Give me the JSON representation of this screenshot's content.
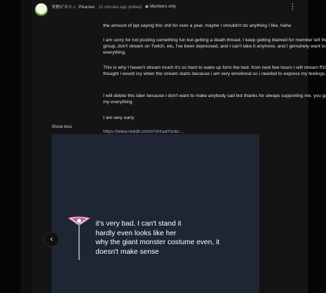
{
  "author": {
    "username": "天野ピカミィ. Pikamee",
    "timestamp": "22 minutes ago (edited)",
    "badge": "Members only"
  },
  "icons": {
    "more": "more-vert-icon",
    "prev": "chevron-left-icon",
    "badge": "members-check-icon",
    "avatar": "avatar-image"
  },
  "post": {
    "paragraph1": "the amount of ppl saying this shit for over a year, maybe I shouldn't do anything I like, haha",
    "paragraph2": "I am sorry for not posting something fun but getting a death thread, I keep getting blamed for member left the group, don't stream on Twitch, etc, I've been depressed, and I can't take it anymore, and I genuinely want to drop everything.",
    "paragraph3": "This is why I haven't stream much it's so hard to wake up form the bed. from next few hours I will stream ff10 but i thought i would cry when the stream starts because i am very emotional so i needed to express my feelings.",
    "paragraph4": "I will delete this later because i don't want to make anybody sad but thanks for always supporting me. you guys are my everything",
    "paragraph5": "I am very sorry",
    "link": "https://www.reddit.com/r/VirtualYoutu...,",
    "show_less": "Show less"
  },
  "media": {
    "line1": "it's very bad, I can't stand it",
    "line2": "hardly even looks like her",
    "line3": "why the giant monster costume even, it",
    "line4": "doesn't make sense"
  },
  "colors": {
    "background": "#0f0f0f",
    "post_background": "#141414",
    "media_background": "#1e2633",
    "badge_green": "#2e7d32",
    "link": "#9fb3d8"
  }
}
